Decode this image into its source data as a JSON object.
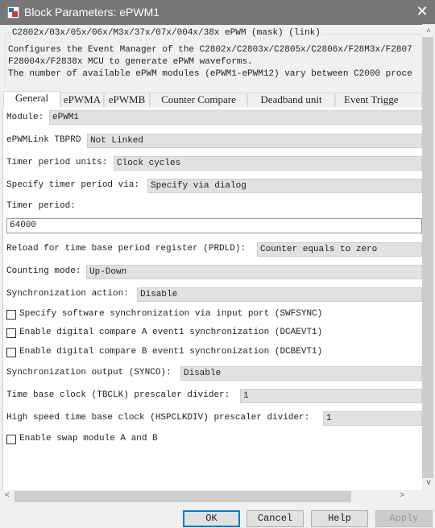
{
  "window": {
    "title": "Block Parameters: ePWM1",
    "close_icon": "close-icon"
  },
  "mask": {
    "title": "C2802x/03x/05x/06x/M3x/37x/07x/004x/38x ePWM (mask) (link)",
    "description": [
      "Configures the Event Manager of the C2802x/C2803x/C2805x/C2806x/F28M3x/F2807",
      "F28004x/F2838x MCU to generate ePWM waveforms.",
      "The number of available ePWM modules (ePWM1-ePWM12) vary between C2000 proce"
    ]
  },
  "tabs": [
    {
      "label": "General",
      "active": true
    },
    {
      "label": "ePWMA"
    },
    {
      "label": "ePWMB"
    },
    {
      "label": "Counter Compare"
    },
    {
      "label": "Deadband unit"
    },
    {
      "label": "Event Trigge"
    }
  ],
  "general": {
    "module": {
      "label": "Module:",
      "value": "ePWM1"
    },
    "epwmlink": {
      "label": "ePWMLink TBPRD",
      "value": "Not Linked"
    },
    "period_units": {
      "label": "Timer period units:",
      "value": "Clock cycles"
    },
    "period_via": {
      "label": "Specify timer period via:",
      "value": "Specify via dialog"
    },
    "timer_period": {
      "label": "Timer period:",
      "value": "64000"
    },
    "prdld": {
      "label": "Reload for time base period register (PRDLD):",
      "value": "Counter equals to zero"
    },
    "counting_mode": {
      "label": "Counting mode:",
      "value": "Up-Down"
    },
    "sync_action": {
      "label": "Synchronization action:",
      "value": "Disable"
    },
    "checkboxes": [
      {
        "label": "Specify software synchronization via input port (SWFSYNC)",
        "checked": false
      },
      {
        "label": "Enable digital compare A event1 synchronization (DCAEVT1)",
        "checked": false
      },
      {
        "label": "Enable digital compare B event1 synchronization (DCBEVT1)",
        "checked": false
      }
    ],
    "sync_output": {
      "label": "Synchronization output (SYNCO):",
      "value": "Disable"
    },
    "tbclk": {
      "label": "Time base clock (TBCLK) prescaler divider:",
      "value": "1"
    },
    "hspclkdiv": {
      "label": "High speed time base clock (HSPCLKDIV) prescaler divider:",
      "value": "1"
    },
    "swap": {
      "label": "Enable swap module A and B",
      "checked": false
    }
  },
  "buttons": {
    "ok": "OK",
    "cancel": "Cancel",
    "help": "Help",
    "apply": "Apply"
  },
  "scroll": {
    "up": "^",
    "down": "v",
    "left": "<",
    "right": ">"
  }
}
